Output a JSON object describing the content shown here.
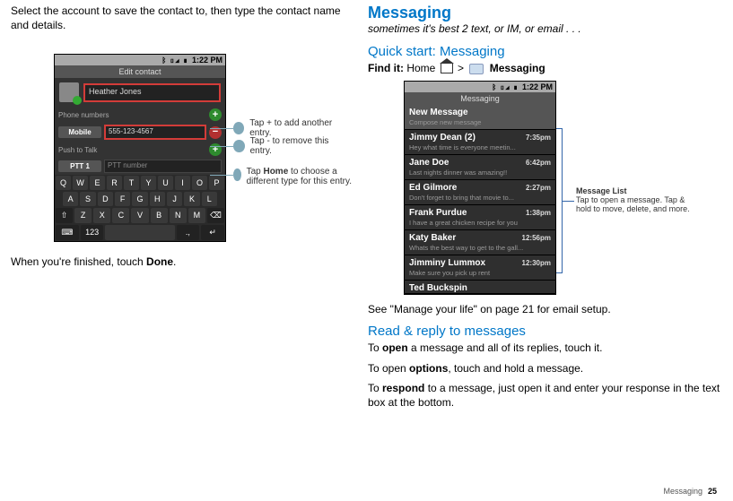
{
  "left": {
    "intro": "Select the account to save the contact to, then type the contact name and details.",
    "outro_pre": "When you're finished, touch ",
    "outro_bold": "Done",
    "outro_post": "."
  },
  "phoneL": {
    "time": "1:22 PM",
    "title": "Edit contact",
    "name": "Heather Jones",
    "sec_phone": "Phone numbers",
    "type_mobile": "Mobile",
    "val_mobile": "555-123-4567",
    "sec_ptt": "Push to Talk",
    "type_ptt": "PTT 1",
    "val_ptt": "PTT number",
    "kbd": {
      "r1": [
        "Q",
        "W",
        "E",
        "R",
        "T",
        "Y",
        "U",
        "I",
        "O",
        "P"
      ],
      "r2": [
        "A",
        "S",
        "D",
        "F",
        "G",
        "H",
        "J",
        "K",
        "L"
      ],
      "r3": [
        "⇧",
        "Z",
        "X",
        "C",
        "V",
        "B",
        "N",
        "M",
        "⌫"
      ],
      "r4": [
        "⌨",
        "123",
        "",
        ".,",
        "↵"
      ]
    },
    "callouts": {
      "add": "Tap + to add another entry.",
      "remove": "Tap - to remove this entry.",
      "home_pre": "Tap ",
      "home_bold": "Home",
      "home_post": " to choose a different type for this entry."
    }
  },
  "right": {
    "h1": "Messaging",
    "tagline": "sometimes it's best 2 text, or IM, or email . . .",
    "h2a": "Quick start: Messaging",
    "findit_pre": "Find it:",
    "findit_home": " Home ",
    "findit_gt": " > ",
    "findit_label": " Messaging",
    "see_email": "See \"Manage your life\" on page 21 for email setup.",
    "h2b": "Read & reply to messages",
    "p1_pre": "To ",
    "p1_b": "open",
    "p1_post": " a message and all of its replies, touch it.",
    "p2_pre": "To open ",
    "p2_b": "options",
    "p2_post": ", touch and hold a message.",
    "p3_pre": "To ",
    "p3_b": "respond",
    "p3_post": " to a message, just open it and enter your response in the text box at the bottom."
  },
  "phoneR": {
    "time": "1:22 PM",
    "title": "Messaging",
    "items": [
      {
        "name": "New Message",
        "sub": "Compose new message",
        "time": ""
      },
      {
        "name": "Jimmy Dean (2)",
        "sub": "Hey what time is everyone meetin...",
        "time": "7:35pm"
      },
      {
        "name": "Jane Doe",
        "sub": "Last nights dinner was amazing!!",
        "time": "6:42pm"
      },
      {
        "name": "Ed Gilmore",
        "sub": "Don't forget to bring that movie to...",
        "time": "2:27pm"
      },
      {
        "name": "Frank Purdue",
        "sub": "I have a great chicken recipe for you",
        "time": "1:38pm"
      },
      {
        "name": "Katy Baker",
        "sub": "Whats the best way to get to the gall...",
        "time": "12:56pm"
      },
      {
        "name": "Jimminy Lummox",
        "sub": "Make sure you pick up rent",
        "time": "12:30pm"
      },
      {
        "name": "Ted Buckspin",
        "sub": "",
        "time": ""
      }
    ],
    "annot_hd": "Message List",
    "annot_body": "Tap to open a message. Tap & hold to move, delete, and more."
  },
  "footer": {
    "section": "Messaging",
    "page": "25"
  }
}
